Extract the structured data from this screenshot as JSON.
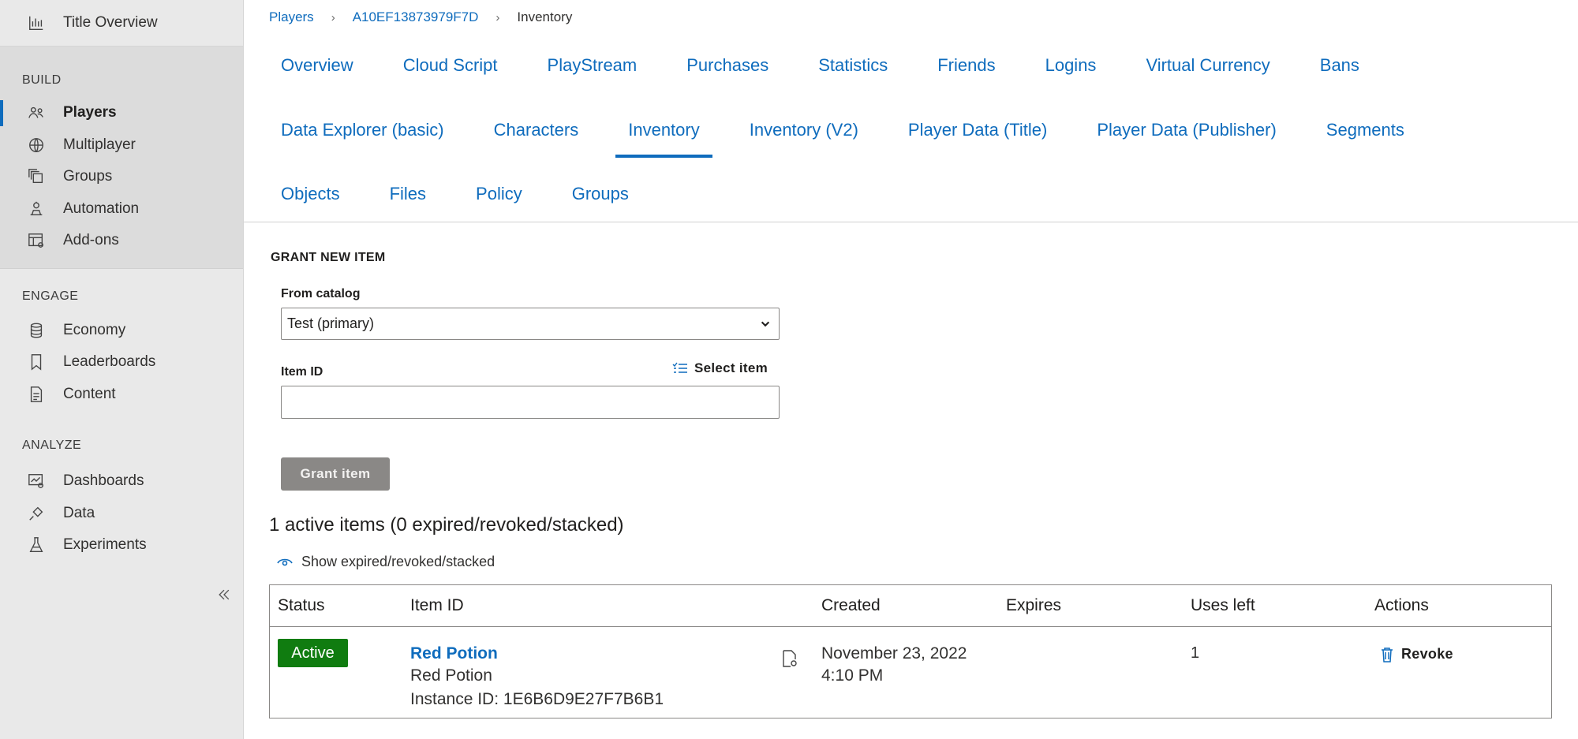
{
  "sidebar": {
    "title_overview": "Title Overview",
    "sections": [
      {
        "heading": "BUILD",
        "items": [
          "Players",
          "Multiplayer",
          "Groups",
          "Automation",
          "Add-ons"
        ]
      },
      {
        "heading": "ENGAGE",
        "items": [
          "Economy",
          "Leaderboards",
          "Content"
        ]
      },
      {
        "heading": "ANALYZE",
        "items": [
          "Dashboards",
          "Data",
          "Experiments"
        ]
      }
    ],
    "active_item": "Players"
  },
  "breadcrumb": {
    "items": [
      "Players",
      "A10EF13873979F7D",
      "Inventory"
    ]
  },
  "tabs": {
    "row1": [
      "Overview",
      "Cloud Script",
      "PlayStream",
      "Purchases",
      "Statistics",
      "Friends",
      "Logins",
      "Virtual Currency",
      "Bans"
    ],
    "row2": [
      "Data Explorer (basic)",
      "Characters",
      "Inventory",
      "Inventory (V2)",
      "Player Data (Title)",
      "Player Data (Publisher)",
      "Segments"
    ],
    "row3": [
      "Objects",
      "Files",
      "Policy",
      "Groups"
    ],
    "selected": "Inventory"
  },
  "grant": {
    "title": "GRANT NEW ITEM",
    "catalog_label": "From catalog",
    "catalog_value": "Test (primary)",
    "item_id_label": "Item ID",
    "select_item_label": "Select item",
    "item_id_value": "",
    "button_label": "Grant item"
  },
  "inventory": {
    "summary": "1 active items (0 expired/revoked/stacked)",
    "show_expired_label": "Show expired/revoked/stacked",
    "columns": [
      "Status",
      "Item ID",
      "Created",
      "Expires",
      "Uses left",
      "Actions"
    ],
    "rows": [
      {
        "status": "Active",
        "item_id_link": "Red Potion",
        "display_name": "Red Potion",
        "instance_id": "Instance ID: 1E6B6D9E27F7B6B1",
        "created_date": "November 23, 2022",
        "created_time": "4:10 PM",
        "expires": "",
        "uses_left": "1",
        "action_label": "Revoke"
      }
    ]
  },
  "colors": {
    "accent": "#0f6cbd",
    "active_badge": "#107c10",
    "sidebar_bg": "#e9e9e9",
    "disabled_button": "#8a8886"
  }
}
